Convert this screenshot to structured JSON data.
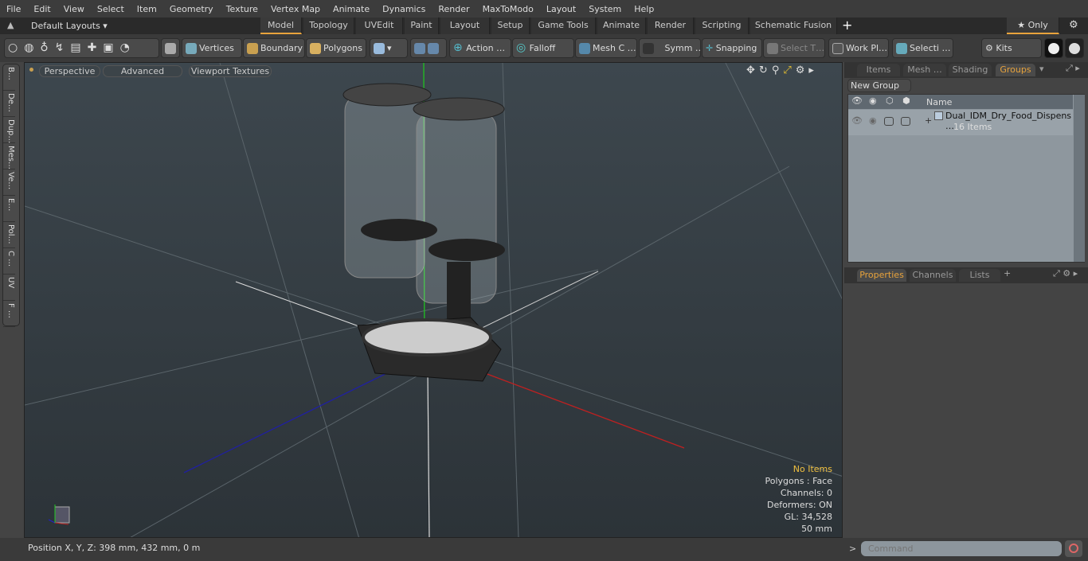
{
  "menu": [
    "File",
    "Edit",
    "View",
    "Select",
    "Item",
    "Geometry",
    "Texture",
    "Vertex Map",
    "Animate",
    "Dynamics",
    "Render",
    "MaxToModo",
    "Layout",
    "System",
    "Help"
  ],
  "layouts": {
    "label": "Default Layouts ▾",
    "tabs": [
      "Model",
      "Topology",
      "UVEdit",
      "Paint",
      "Layout",
      "Setup",
      "Game Tools",
      "Animate",
      "Render",
      "Scripting",
      "Schematic Fusion"
    ],
    "active": "Model",
    "only": "★  Only"
  },
  "toolbar": {
    "vertices": "Vertices",
    "boundary": "Boundary",
    "polygons": "Polygons",
    "action": "Action   …",
    "falloff": "Falloff",
    "mesh": "Mesh C …",
    "symm": "Symm …",
    "snapping": "Snapping",
    "select_t": "Select T…",
    "work_pl": "Work Pl…",
    "selecti": "Selecti …",
    "kits": "Kits"
  },
  "left_tabs": [
    "B…",
    "De…",
    "Dup…",
    "Mes…",
    "Ve…",
    "E…",
    "Pol…",
    "C …",
    "UV",
    "F …"
  ],
  "viewport": {
    "perspective": "Perspective",
    "advanced": "Advanced",
    "textures": "Viewport Textures",
    "info": {
      "selection": "No Items",
      "polygons": "Polygons : Face",
      "channels": "Channels: 0",
      "deformers": "Deformers: ON",
      "gl": "GL: 34,528",
      "scale": "50 mm"
    }
  },
  "groups_panel": {
    "tabs": [
      "Items",
      "Mesh …",
      "Shading",
      "Groups"
    ],
    "active": "Groups",
    "new_group": "New Group",
    "col_name": "Name",
    "item": {
      "name": "Dual_IDM_Dry_Food_Dispens …",
      "count": "16 Items"
    }
  },
  "props_panel": {
    "tabs": [
      "Properties",
      "Channels",
      "Lists"
    ],
    "active": "Properties"
  },
  "status": {
    "position": "Position X, Y, Z:  398 mm, 432 mm, 0 m"
  },
  "command": {
    "placeholder": "Command"
  },
  "colors": {
    "accent": "#e8a33c",
    "info_highlight": "#f0c040",
    "x_axis": "#c02020",
    "y_axis": "#20c020",
    "z_axis": "#2020a0"
  }
}
